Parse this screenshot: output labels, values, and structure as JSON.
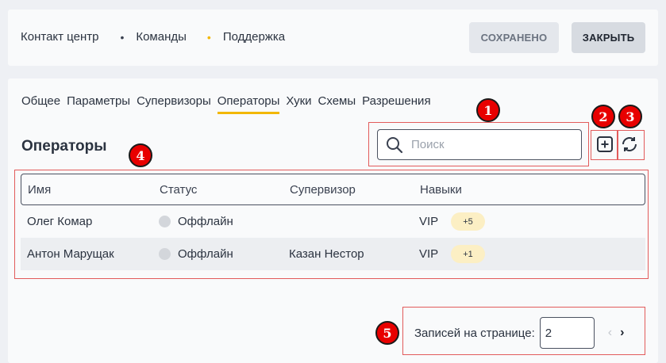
{
  "breadcrumbs": [
    "Контакт центр",
    "Команды",
    "Поддержка"
  ],
  "breadcrumb_separator": "•",
  "buttons": {
    "saved": "СОХРАНЕНО",
    "close": "ЗАКРЫТЬ"
  },
  "tabs": [
    "Общее",
    "Параметры",
    "Супервизоры",
    "Операторы",
    "Хуки",
    "Схемы",
    "Разрешения"
  ],
  "active_tab": "Операторы",
  "page_title": "Операторы",
  "search": {
    "placeholder": "Поиск",
    "value": "",
    "icon": "search-icon"
  },
  "toolbar_icons": [
    "add-icon",
    "refresh-icon"
  ],
  "table": {
    "columns": [
      "Имя",
      "Статус",
      "Супервизор",
      "Навыки"
    ],
    "rows": [
      {
        "name": "Олег Комар",
        "status": "Оффлайн",
        "supervisor": "",
        "skill": "VIP",
        "more": "+5"
      },
      {
        "name": "Антон Марущак",
        "status": "Оффлайн",
        "supervisor": "Казан Нестор",
        "skill": "VIP",
        "more": "+1"
      }
    ]
  },
  "pagination": {
    "label": "Записей на странице:",
    "value": "2",
    "prev": "‹",
    "next": "›"
  },
  "annotations": [
    "1",
    "2",
    "3",
    "4",
    "5"
  ],
  "colors": {
    "accent": "#f2b705",
    "annotation": "#e80000",
    "highlight": "#e25b5b",
    "badge": "#fcefc4"
  }
}
